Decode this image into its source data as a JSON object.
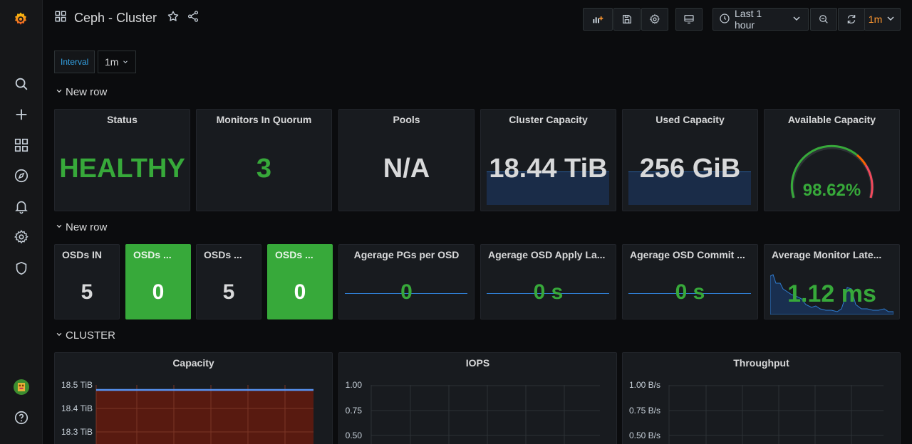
{
  "topbar": {
    "title": "Ceph - Cluster",
    "time_range": "Last 1 hour",
    "refresh_interval": "1m"
  },
  "variables": {
    "interval_label": "Interval",
    "interval_value": "1m"
  },
  "rows": {
    "row1": "New row",
    "row2": "New row",
    "row3": "CLUSTER"
  },
  "panels": {
    "status": {
      "title": "Status",
      "value": "HEALTHY"
    },
    "monitors": {
      "title": "Monitors In Quorum",
      "value": "3"
    },
    "pools": {
      "title": "Pools",
      "value": "N/A"
    },
    "cluster_capacity": {
      "title": "Cluster Capacity",
      "value": "18.44 TiB"
    },
    "used_capacity": {
      "title": "Used Capacity",
      "value": "256 GiB"
    },
    "available_capacity": {
      "title": "Available Capacity",
      "value": "98.62%",
      "gauge_percent": 98.62
    },
    "osds_in": {
      "title": "OSDs IN",
      "value": "5"
    },
    "osds_2": {
      "title": "OSDs ...",
      "value": "0"
    },
    "osds_3": {
      "title": "OSDs ...",
      "value": "5"
    },
    "osds_4": {
      "title": "OSDs ...",
      "value": "0"
    },
    "avg_pgs": {
      "title": "Agerage PGs per OSD",
      "value": "0"
    },
    "avg_apply": {
      "title": "Agerage OSD Apply La...",
      "value": "0 s"
    },
    "avg_commit": {
      "title": "Agerage OSD Commit ...",
      "value": "0 s"
    },
    "avg_monitor": {
      "title": "Average Monitor Late...",
      "value": "1.12 ms"
    },
    "capacity_graph": {
      "title": "Capacity",
      "yticks": [
        "18.5 TiB",
        "18.4 TiB",
        "18.3 TiB"
      ]
    },
    "iops_graph": {
      "title": "IOPS",
      "yticks": [
        "1.00",
        "0.75",
        "0.50"
      ]
    },
    "throughput_graph": {
      "title": "Throughput",
      "yticks": [
        "1.00 B/s",
        "0.75 B/s",
        "0.50 B/s"
      ]
    }
  },
  "colors": {
    "accent_green": "#37a93a",
    "refresh_orange": "#ff9830",
    "link_blue": "#33a2e5"
  }
}
